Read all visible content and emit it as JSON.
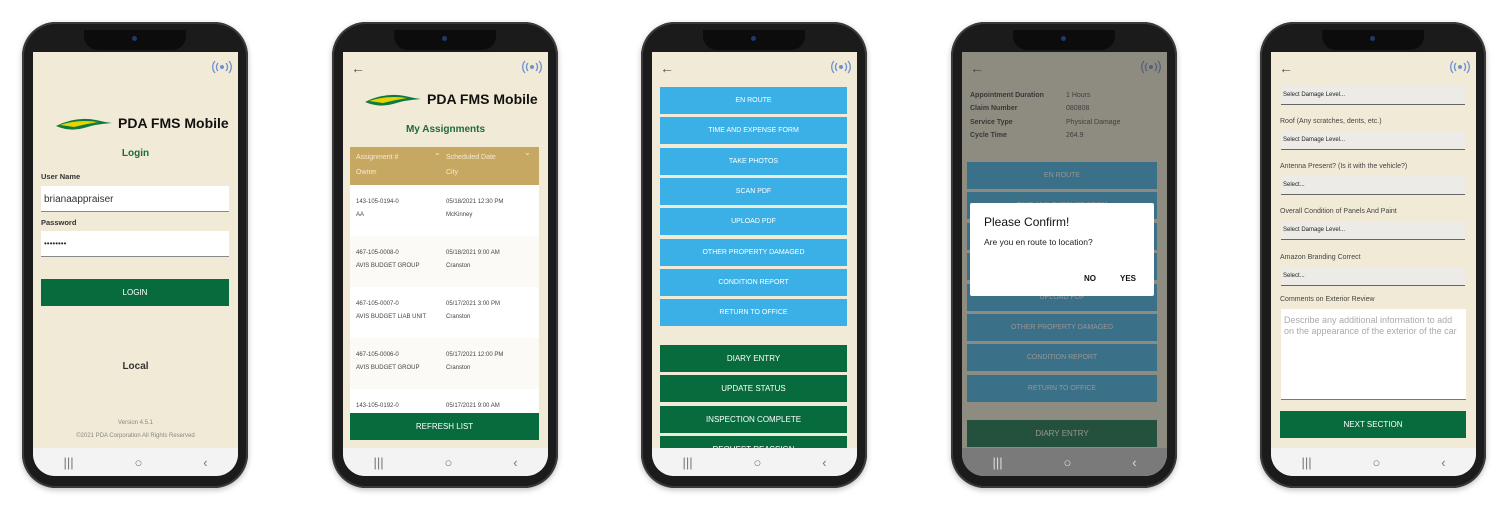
{
  "app": {
    "title": "PDA FMS Mobile",
    "colors": {
      "background": "#f1ead6",
      "green": "#086b3e",
      "blue": "#3ab0e6",
      "table_header": "#c7a862"
    }
  },
  "icons": {
    "signal": "signal-broadcast-icon",
    "back": "arrow-left-icon",
    "nav": [
      "recent-apps-icon",
      "home-icon",
      "back-nav-icon"
    ]
  },
  "login": {
    "heading": "Login",
    "username_label": "User Name",
    "username_value": "brianaappraiser",
    "password_label": "Password",
    "password_value": "••••••••",
    "login_button": "LOGIN",
    "environment": "Local",
    "version": "Version 4.5.1",
    "copyright": "©2021 PDA Corporation All Rights Reserved"
  },
  "assignments": {
    "heading": "My Assignments",
    "columns": {
      "col1_top": "Assignment #",
      "col1_bottom": "Owner",
      "col2_top": "Scheduled Date",
      "col2_bottom": "City"
    },
    "rows": [
      {
        "number": "143-105-0194-0",
        "owner": "AA",
        "date": "05/18/2021 12:30 PM",
        "city": "McKinney"
      },
      {
        "number": "467-105-0008-0",
        "owner": "AVIS BUDGET GROUP",
        "date": "05/18/2021 9:00 AM",
        "city": "Cranston"
      },
      {
        "number": "467-105-0007-0",
        "owner": "AVIS BUDGET LIAB UNIT",
        "date": "05/17/2021 3:00 PM",
        "city": "Cranston"
      },
      {
        "number": "467-105-0006-0",
        "owner": "AVIS BUDGET GROUP",
        "date": "05/17/2021 12:00 PM",
        "city": "Cranston"
      },
      {
        "number": "143-105-0192-0",
        "owner": "",
        "date": "05/17/2021 9:00 AM",
        "city": ""
      }
    ],
    "refresh_button": "REFRESH LIST"
  },
  "actions": {
    "blue": [
      "EN ROUTE",
      "TIME AND EXPENSE FORM",
      "TAKE PHOTOS",
      "SCAN PDF",
      "UPLOAD PDF",
      "OTHER PROPERTY DAMAGED",
      "CONDITION REPORT",
      "RETURN TO OFFICE"
    ],
    "green": [
      "DIARY ENTRY",
      "UPDATE STATUS",
      "INSPECTION COMPLETE",
      "REQUEST REASSIGN"
    ]
  },
  "details": {
    "rows": [
      {
        "label": "Appointment Duration",
        "value": "1 Hours"
      },
      {
        "label": "Claim Number",
        "value": "080808"
      },
      {
        "label": "Service Type",
        "value": "Physical Damage"
      },
      {
        "label": "Cycle Time",
        "value": "264.9"
      }
    ]
  },
  "dialog": {
    "title": "Please Confirm!",
    "message": "Are you en route to location?",
    "no": "NO",
    "yes": "YES"
  },
  "form": {
    "fields": [
      {
        "label": "",
        "value": "Select Damage Level..."
      },
      {
        "label": "Roof (Any scratches, dents, etc.)",
        "value": "Select Damage Level..."
      },
      {
        "label": "Antenna Present? (Is it with the vehicle?)",
        "value": "Select..."
      },
      {
        "label": "Overall Condition of Panels And Paint",
        "value": "Select Damage Level..."
      },
      {
        "label": "Amazon Branding Correct",
        "value": "Select..."
      }
    ],
    "comments_label": "Comments on Exterior Review",
    "comments_placeholder": "Describe any additional information to add on the appearance of the exterior of the car",
    "next_button": "NEXT SECTION"
  }
}
